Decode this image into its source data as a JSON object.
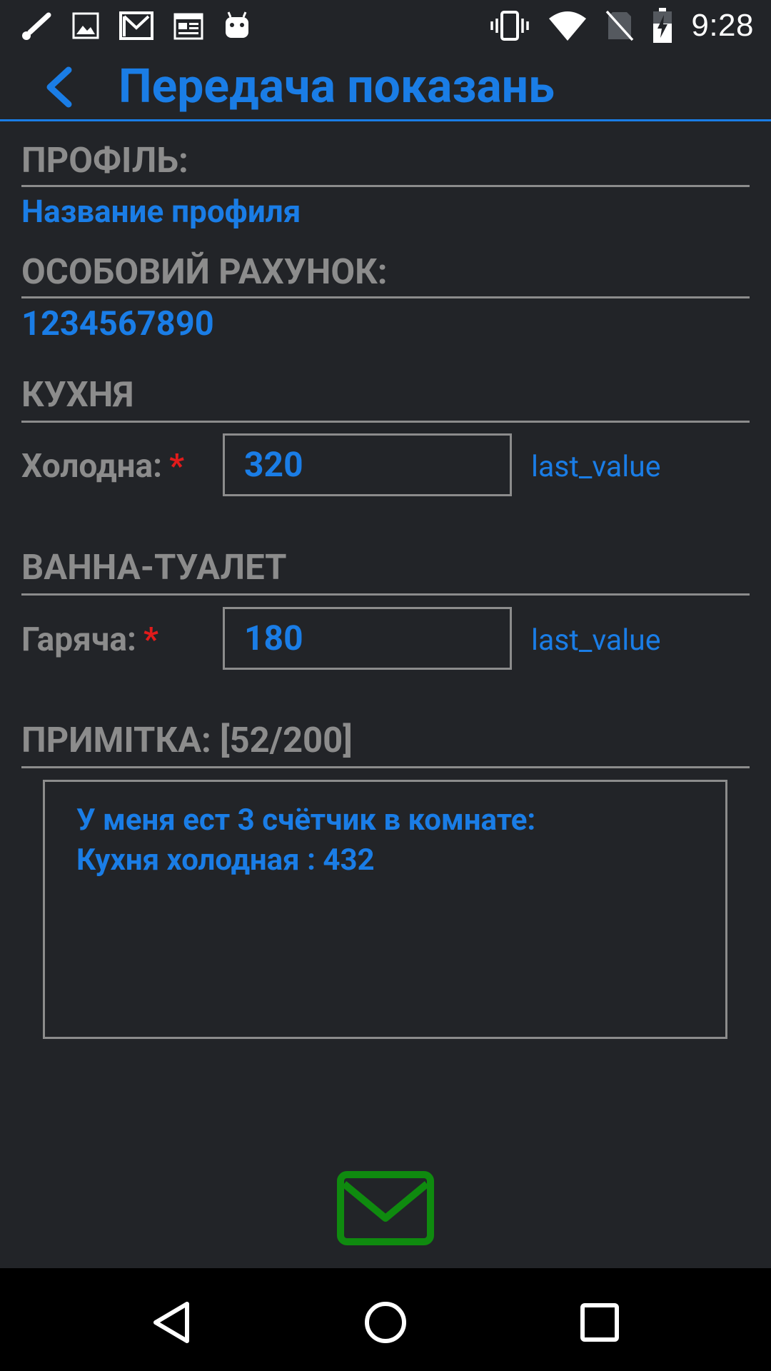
{
  "status_bar": {
    "time": "9:28",
    "left_icons": [
      "wrench-icon",
      "image-icon",
      "gmail-icon",
      "calendar-icon",
      "android-icon"
    ],
    "right_icons": [
      "vibrate-icon",
      "wifi-icon",
      "no-sim-icon",
      "battery-charging-icon"
    ]
  },
  "app_bar": {
    "title": "Передача показань",
    "back_icon": "chevron-left-icon"
  },
  "profile": {
    "label": "ПРОФІЛЬ:",
    "value": "Название профиля"
  },
  "account": {
    "label": "ОСОБОВИЙ РАХУНОК:",
    "value": "1234567890"
  },
  "kitchen": {
    "label": "КУХНЯ",
    "field_label": "Холодна:",
    "required_mark": "*",
    "value": "320",
    "last_value": "last_value"
  },
  "bathroom": {
    "label": "ВАННА-ТУАЛЕТ",
    "field_label": "Гаряча:",
    "required_mark": "*",
    "value": "180",
    "last_value": "last_value"
  },
  "note": {
    "label": "ПРИМІТКА: [52/200]",
    "lines": [
      "У меня ест 3 счётчик в комнате:",
      "Кухня холодная : 432"
    ]
  },
  "send_icon": "envelope-icon",
  "colors": {
    "accent": "#1a7de6",
    "label_gray": "#8c8c8c",
    "required": "#e11b1b",
    "send_green": "#0f8a0f",
    "background": "#222428"
  }
}
